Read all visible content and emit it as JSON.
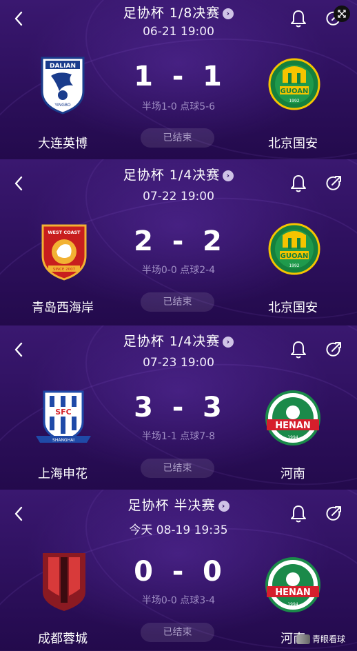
{
  "colors": {
    "background": "#2a0f57",
    "muted_text": "#9f8dc4",
    "status_text": "#a99bc4"
  },
  "watermark": {
    "text": "青眼看球"
  },
  "matches": [
    {
      "round": "足协杯 1/8决赛",
      "time": "06-21 19:00",
      "home": {
        "name": "大连英博",
        "logo": "dalian-yingbo-logo",
        "logo_text": "DALIAN",
        "logo_sub": "YINGBO"
      },
      "away": {
        "name": "北京国安",
        "logo": "beijing-guoan-logo",
        "logo_text": "GUOAN",
        "logo_sub": "1992"
      },
      "home_score": "1",
      "away_score": "1",
      "dash": "-",
      "detail": "半场1-0 点球5-6",
      "status": "已结束"
    },
    {
      "round": "足协杯 1/4决赛",
      "time": "07-22 19:00",
      "home": {
        "name": "青岛西海岸",
        "logo": "qingdao-westcoast-logo",
        "logo_text": "WEST COAST",
        "logo_sub": "SINCE 2007"
      },
      "away": {
        "name": "北京国安",
        "logo": "beijing-guoan-logo",
        "logo_text": "GUOAN",
        "logo_sub": "1992"
      },
      "home_score": "2",
      "away_score": "2",
      "dash": "-",
      "detail": "半场0-0 点球2-4",
      "status": "已结束"
    },
    {
      "round": "足协杯 1/4决赛",
      "time": "07-23 19:00",
      "home": {
        "name": "上海申花",
        "logo": "shanghai-shenhua-logo",
        "logo_text": "SFC",
        "logo_sub": "SHANGHAI"
      },
      "away": {
        "name": "河南",
        "logo": "henan-logo",
        "logo_text": "HENAN",
        "logo_sub": "1994"
      },
      "home_score": "3",
      "away_score": "3",
      "dash": "-",
      "detail": "半场1-1 点球7-8",
      "status": "已结束"
    },
    {
      "round": "足协杯 半决赛",
      "time": "今天 08-19 19:35",
      "home": {
        "name": "成都蓉城",
        "logo": "chengdu-rongcheng-logo",
        "logo_text": "",
        "logo_sub": ""
      },
      "away": {
        "name": "河南",
        "logo": "henan-logo",
        "logo_text": "HENAN",
        "logo_sub": "1994"
      },
      "home_score": "0",
      "away_score": "0",
      "dash": "-",
      "detail": "半场0-0 点球3-4",
      "status": "已结束"
    }
  ]
}
